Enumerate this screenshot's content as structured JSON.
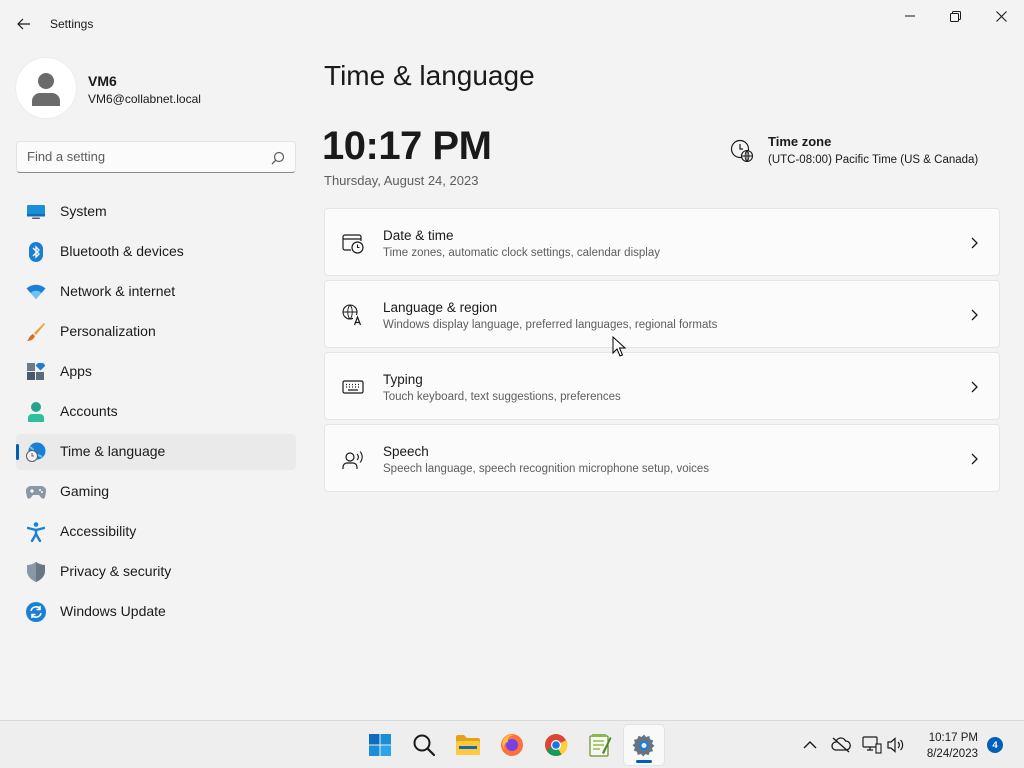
{
  "window": {
    "title": "Settings"
  },
  "profile": {
    "name": "VM6",
    "email": "VM6@collabnet.local"
  },
  "search": {
    "placeholder": "Find a setting"
  },
  "sidebar": {
    "items": [
      {
        "label": "System",
        "icon": "system-icon"
      },
      {
        "label": "Bluetooth & devices",
        "icon": "bluetooth-icon"
      },
      {
        "label": "Network & internet",
        "icon": "wifi-icon"
      },
      {
        "label": "Personalization",
        "icon": "brush-icon"
      },
      {
        "label": "Apps",
        "icon": "apps-icon"
      },
      {
        "label": "Accounts",
        "icon": "person-icon"
      },
      {
        "label": "Time & language",
        "icon": "globe-clock-icon",
        "active": true
      },
      {
        "label": "Gaming",
        "icon": "gamepad-icon"
      },
      {
        "label": "Accessibility",
        "icon": "accessibility-icon"
      },
      {
        "label": "Privacy & security",
        "icon": "shield-icon"
      },
      {
        "label": "Windows Update",
        "icon": "sync-icon"
      }
    ]
  },
  "main": {
    "title": "Time & language",
    "clock": "10:17 PM",
    "date": "Thursday, August 24, 2023",
    "timezone": {
      "label": "Time zone",
      "value": "(UTC-08:00) Pacific Time (US & Canada)"
    },
    "cards": [
      {
        "title": "Date & time",
        "description": "Time zones, automatic clock settings, calendar display",
        "icon": "calendar-clock-icon"
      },
      {
        "title": "Language & region",
        "description": "Windows display language, preferred languages, regional formats",
        "icon": "language-icon"
      },
      {
        "title": "Typing",
        "description": "Touch keyboard, text suggestions, preferences",
        "icon": "keyboard-icon"
      },
      {
        "title": "Speech",
        "description": "Speech language, speech recognition microphone setup, voices",
        "icon": "speech-icon"
      }
    ]
  },
  "taskbar": {
    "time": "10:17 PM",
    "date": "8/24/2023",
    "notification_count": "4"
  },
  "colors": {
    "accent": "#005fb8",
    "background": "#f3f3f3",
    "card": "#fbfbfb"
  }
}
